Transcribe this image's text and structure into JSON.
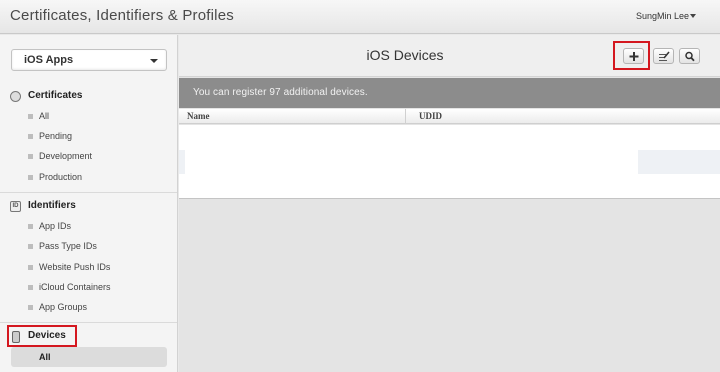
{
  "header": {
    "title": "Certificates, Identifiers & Profiles",
    "user_name": "SungMin Lee"
  },
  "sidebar": {
    "platform_label": "iOS Apps",
    "sections": [
      {
        "label": "Certificates",
        "icon": "certificate-icon",
        "items": [
          "All",
          "Pending",
          "Development",
          "Production"
        ]
      },
      {
        "label": "Identifiers",
        "icon": "id-icon",
        "icon_text": "ID",
        "items": [
          "App IDs",
          "Pass Type IDs",
          "Website Push IDs",
          "iCloud Containers",
          "App Groups"
        ]
      },
      {
        "label": "Devices",
        "icon": "device-icon",
        "items": [
          "All"
        ],
        "selected_item": "All"
      }
    ]
  },
  "main": {
    "title": "iOS Devices",
    "banner": "You can register 97 additional devices.",
    "columns": [
      "Name",
      "UDID"
    ],
    "toolbar_icons": [
      "plus-icon",
      "edit-icon",
      "search-icon"
    ]
  },
  "colors": {
    "highlight": "#d4171f",
    "banner_bg": "#8c8c8c"
  }
}
